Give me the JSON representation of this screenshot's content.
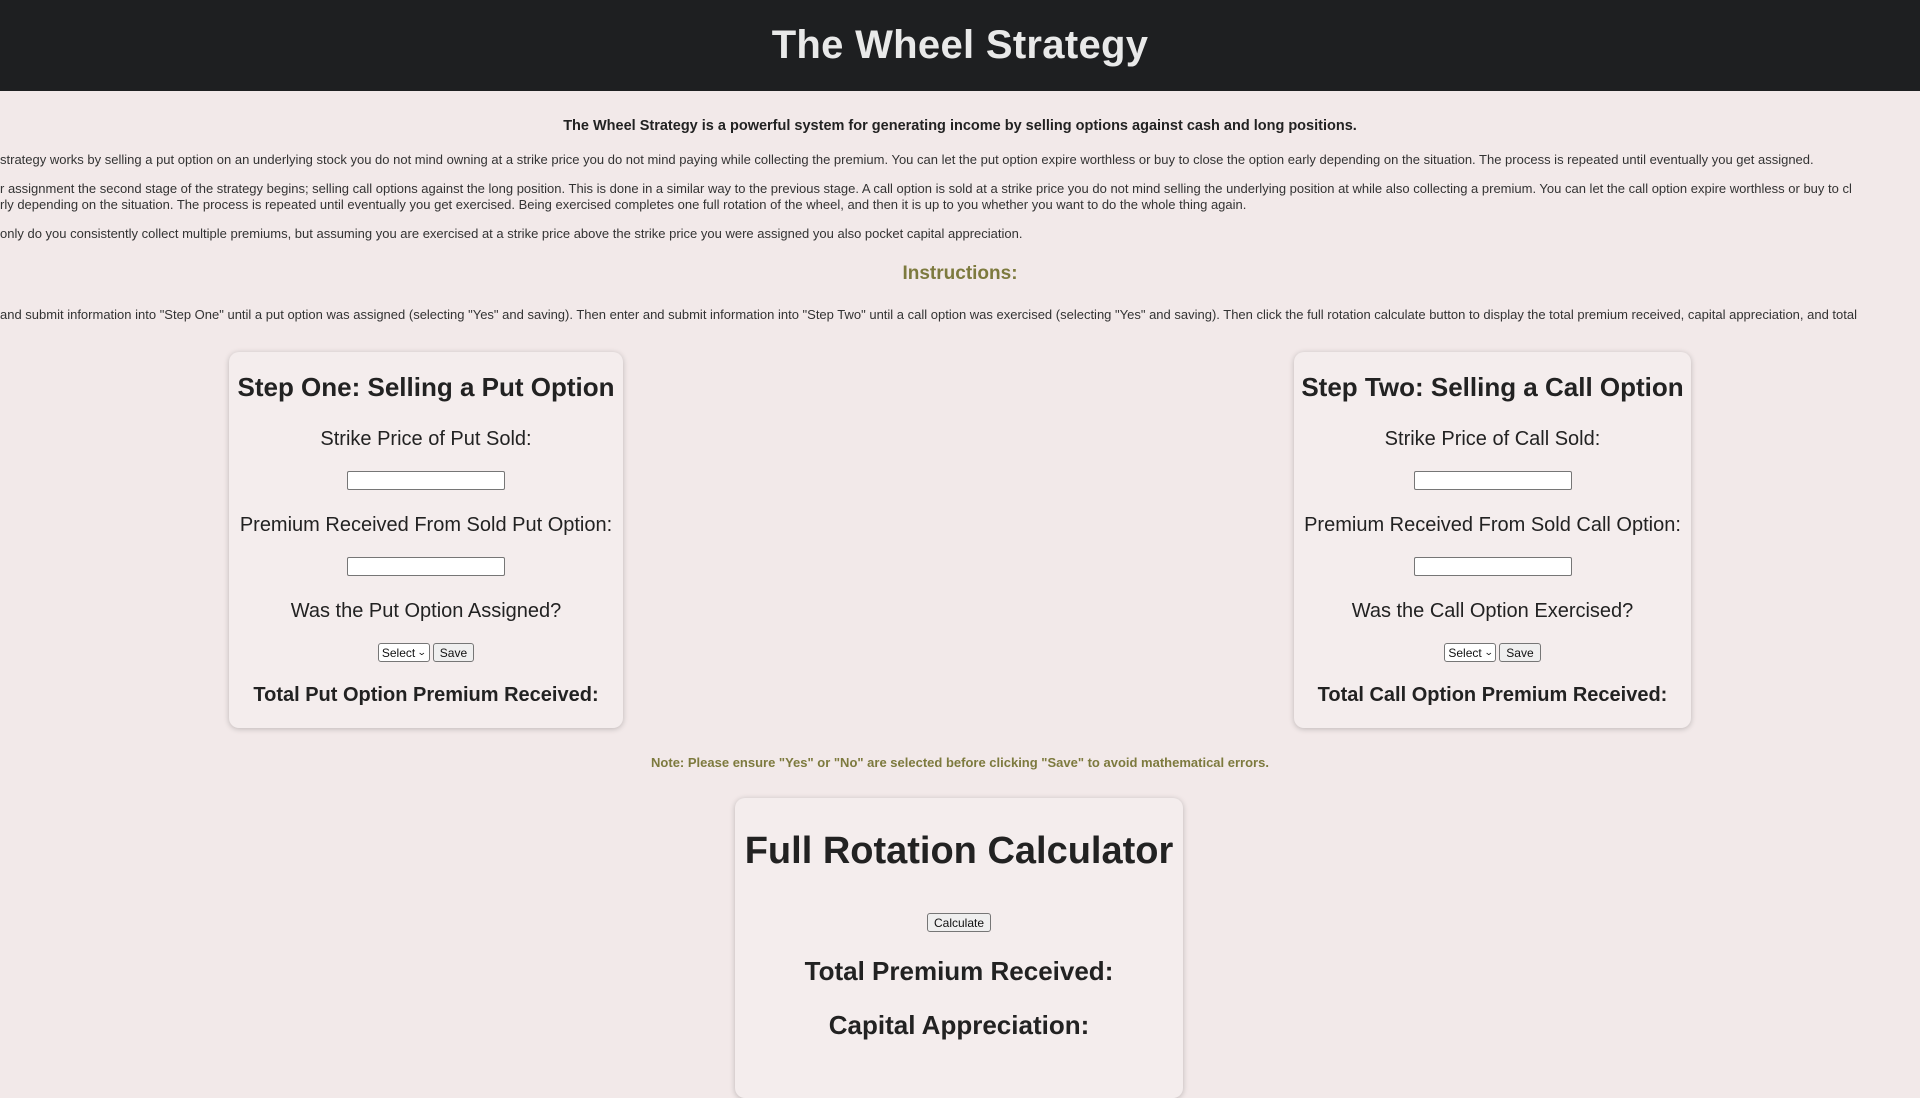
{
  "header": {
    "title": "The Wheel Strategy"
  },
  "intro": {
    "lead": "The Wheel Strategy is a powerful system for generating income by selling options against cash and long positions.",
    "para1": "strategy works by selling a put option on an underlying stock you do not mind owning at a strike price you do not mind paying while collecting the premium. You can let the put option expire worthless or buy to close the option early depending on the situation. The process is repeated until eventually you get assigned.",
    "para2_line1": "r assignment the second stage of the strategy begins; selling call options against the long position. This is done in a similar way to the previous stage. A call option is sold at a strike price you do not mind selling the underlying position at while also collecting a premium. You can let the call option expire worthless or buy to cl",
    "para2_line2": "rly depending on the situation. The process is repeated until eventually you get exercised. Being exercised completes one full rotation of the wheel, and then it is up to you whether you want to do the whole thing again.",
    "para3": "only do you consistently collect multiple premiums, but assuming you are exercised at a strike price above the strike price you were assigned you also pocket capital appreciation."
  },
  "instructions": {
    "title": "Instructions:",
    "text": "and submit information into \"Step One\" until a put option was assigned (selecting \"Yes\" and saving). Then enter and submit information into \"Step Two\" until a call option was exercised (selecting \"Yes\" and saving). Then click the full rotation calculate button to display the total premium received, capital appreciation, and total"
  },
  "step_one": {
    "title": "Step One: Selling a Put Option",
    "strike_label": "Strike Price of Put Sold:",
    "strike_value": "",
    "premium_label": "Premium Received From Sold Put Option:",
    "premium_value": "",
    "assigned_label": "Was the Put Option Assigned?",
    "select_value": "Select",
    "save_label": "Save",
    "total_label": "Total Put Option Premium Received:"
  },
  "step_two": {
    "title": "Step Two: Selling a Call Option",
    "strike_label": "Strike Price of Call Sold:",
    "strike_value": "",
    "premium_label": "Premium Received From Sold Call Option:",
    "premium_value": "",
    "exercised_label": "Was the Call Option Exercised?",
    "select_value": "Select",
    "save_label": "Save",
    "total_label": "Total Call Option Premium Received:"
  },
  "note": "Note: Please ensure \"Yes\" or \"No\" are selected before clicking \"Save\" to avoid mathematical errors.",
  "calculator": {
    "title": "Full Rotation Calculator",
    "calculate_label": "Calculate",
    "total_premium_label": "Total Premium Received:",
    "capital_appreciation_label": "Capital Appreciation:"
  }
}
